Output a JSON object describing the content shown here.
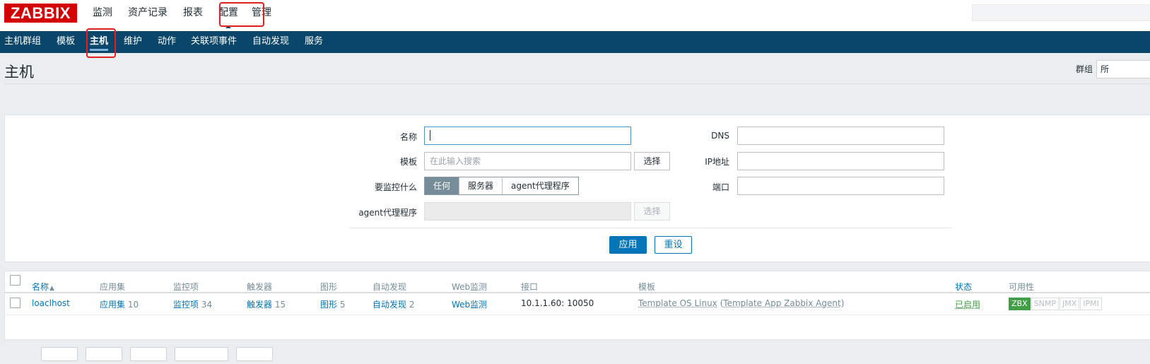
{
  "brand": {
    "logo_text": "ZABBIX",
    "accent": "#d40000",
    "nav_bg": "#0a466a"
  },
  "main_menu": [
    "监测",
    "资产记录",
    "报表",
    "配置",
    "管理"
  ],
  "sub_menu": [
    "主机群组",
    "模板",
    "主机",
    "维护",
    "动作",
    "关联项事件",
    "自动发现",
    "服务"
  ],
  "header": {
    "title": "主机",
    "group_label": "群组",
    "group_value": "所"
  },
  "filter": {
    "name_label": "名称",
    "template_label": "模板",
    "template_placeholder": "在此输入搜索",
    "select_label": "选择",
    "monitor_label": "要监控什么",
    "monitor_options": [
      "任何",
      "服务器",
      "agent代理程序"
    ],
    "proxy_label": "agent代理程序",
    "proxy_select_label": "选择",
    "dns_label": "DNS",
    "ip_label": "IP地址",
    "port_label": "端口",
    "apply_label": "应用",
    "reset_label": "重设"
  },
  "table": {
    "headers": {
      "name": "名称",
      "sort_arrow": "▲",
      "apps": "应用集",
      "items": "监控项",
      "triggers": "触发器",
      "graphs": "图形",
      "discovery": "自动发现",
      "web": "Web监测",
      "interface": "接口",
      "templates": "模板",
      "status": "状态",
      "availability": "可用性"
    },
    "rows": [
      {
        "name": "loaclhost",
        "apps_label": "应用集",
        "apps_count": "10",
        "items_label": "监控项",
        "items_count": "34",
        "triggers_label": "触发器",
        "triggers_count": "15",
        "graphs_label": "图形",
        "graphs_count": "5",
        "discovery_label": "自动发现",
        "discovery_count": "2",
        "web_label": "Web监测",
        "interface": "10.1.1.60: 10050",
        "template_main": "Template OS Linux",
        "paren_open": "(",
        "template_child": "Template App Zabbix Agent",
        "paren_close": ")",
        "status": "已启用",
        "availability": [
          "ZBX",
          "SNMP",
          "JMX",
          "IPMI"
        ]
      }
    ]
  }
}
